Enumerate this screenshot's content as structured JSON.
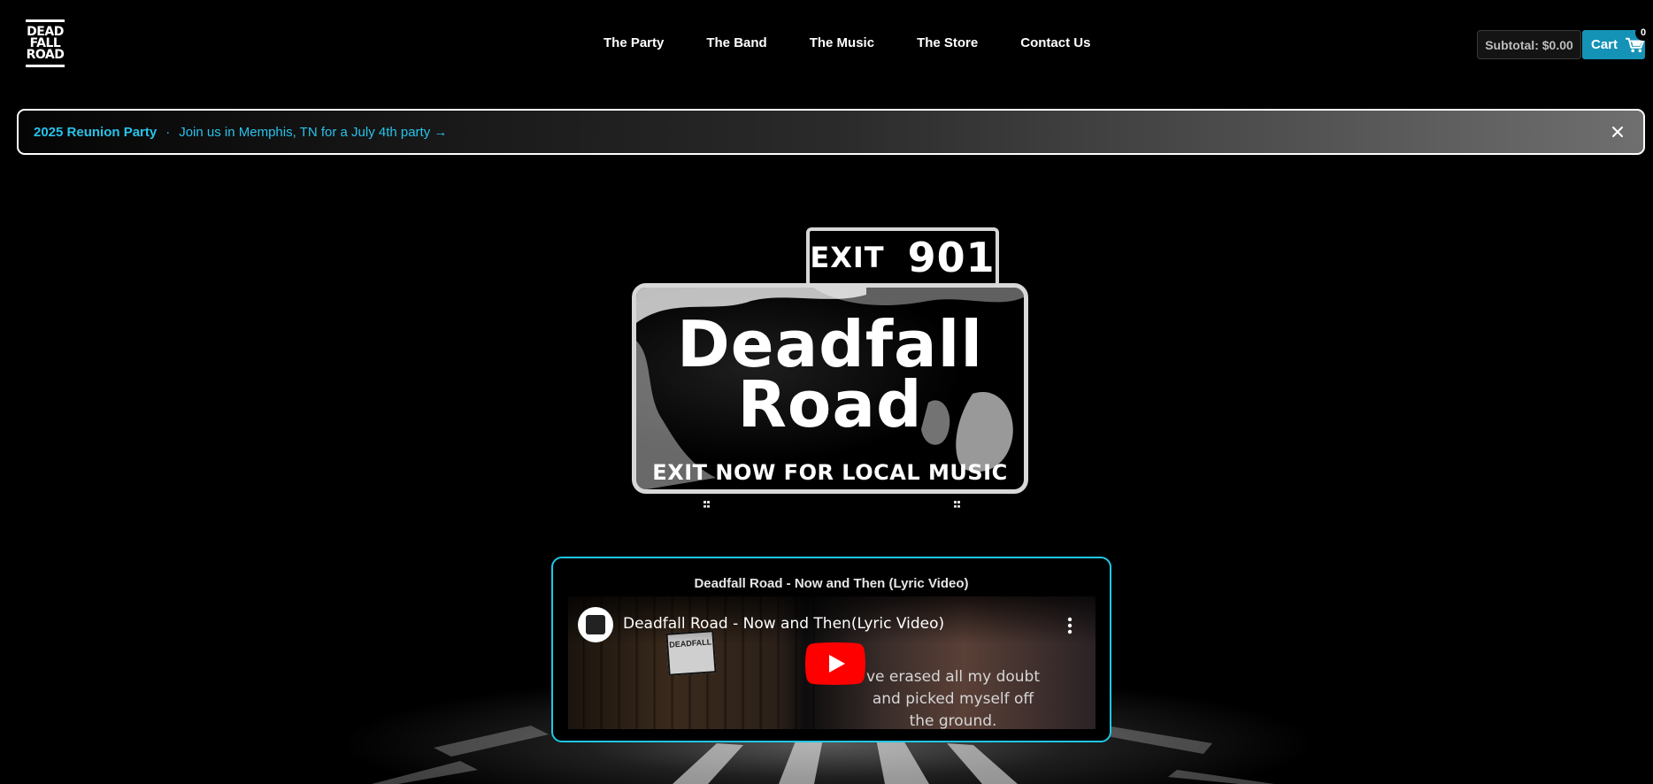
{
  "header": {
    "logo_lines": [
      "DEAD",
      "FALL",
      "ROAD"
    ],
    "nav": [
      {
        "label": "The Party"
      },
      {
        "label": "The Band"
      },
      {
        "label": "The Music"
      },
      {
        "label": "The Store"
      },
      {
        "label": "Contact Us"
      }
    ],
    "subtotal": "Subtotal: $0.00",
    "cart_label": "Cart",
    "cart_count": "0",
    "cart_color": "#1593b7"
  },
  "announcement": {
    "title": "2025 Reunion Party",
    "separator": "·",
    "link_text": "Join us in Memphis, TN for a July 4th party →",
    "close_icon": "close-icon",
    "accent_color": "#27c2ea"
  },
  "hero": {
    "exit_word": "EXIT",
    "exit_number": "901",
    "sign_title_line1": "Deadfall",
    "sign_title_line2": "Road",
    "sign_subtitle": "EXIT NOW FOR LOCAL MUSIC"
  },
  "video": {
    "card_title": "Deadfall Road - Now and Then (Lyric Video)",
    "player_title": "Deadfall Road - Now and Then(Lyric Video)",
    "sticker_text": "DEADFALL",
    "lyrics": [
      "ve erased all my doubt",
      "and picked myself off",
      "the ground."
    ],
    "border_color": "#1ec8e8",
    "play_color": "#ff0000"
  }
}
